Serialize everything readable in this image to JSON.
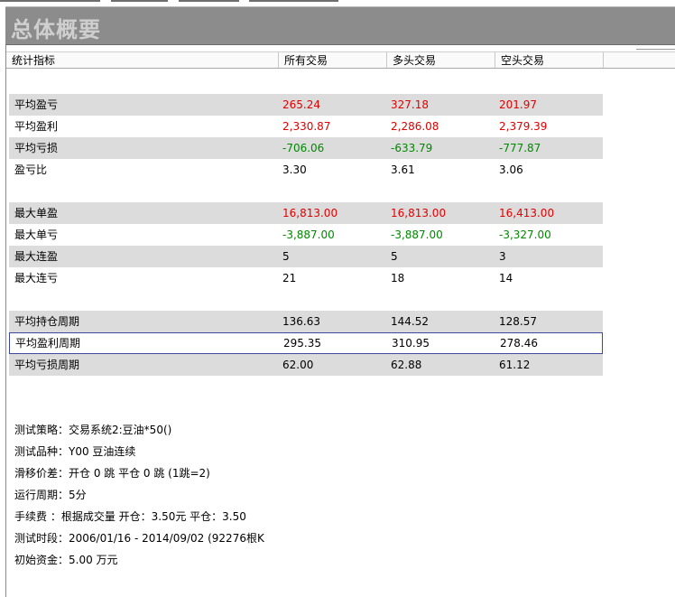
{
  "header": {
    "title": "总体概要",
    "columns": [
      "统计指标",
      "所有交易",
      "多头交易",
      "空头交易"
    ]
  },
  "rows": [
    {
      "label": "平均盈亏",
      "all": "265.24",
      "long": "327.18",
      "short": "201.97",
      "color": "red"
    },
    {
      "label": "平均盈利",
      "all": "2,330.87",
      "long": "2,286.08",
      "short": "2,379.39",
      "color": "red"
    },
    {
      "label": "平均亏损",
      "all": "-706.06",
      "long": "-633.79",
      "short": "-777.87",
      "color": "green"
    },
    {
      "label": "盈亏比",
      "all": "3.30",
      "long": "3.61",
      "short": "3.06",
      "color": "black"
    },
    {
      "label": "最大单盈",
      "all": "16,813.00",
      "long": "16,813.00",
      "short": "16,413.00",
      "color": "red"
    },
    {
      "label": "最大单亏",
      "all": "-3,887.00",
      "long": "-3,887.00",
      "short": "-3,327.00",
      "color": "green"
    },
    {
      "label": "最大连盈",
      "all": "5",
      "long": "5",
      "short": "3",
      "color": "black"
    },
    {
      "label": "最大连亏",
      "all": "21",
      "long": "18",
      "short": "14",
      "color": "black"
    },
    {
      "label": "平均持仓周期",
      "all": "136.63",
      "long": "144.52",
      "short": "128.57",
      "color": "black"
    },
    {
      "label": "平均盈利周期",
      "all": "295.35",
      "long": "310.95",
      "short": "278.46",
      "color": "black"
    },
    {
      "label": "平均亏损周期",
      "all": "62.00",
      "long": "62.88",
      "short": "61.12",
      "color": "black"
    }
  ],
  "info": [
    "测试策略：交易系统2:豆油*50()",
    "测试品种：Y00 豆油连续",
    "滑移价差：开仓 0 跳 平仓 0 跳 (1跳=2)",
    "运行周期：5分",
    "手续费  ：根据成交量 开仓：3.50元 平仓：3.50",
    "测试时段：2006/01/16 - 2014/09/02 (92276根K",
    "初始资金：5.00 万元"
  ],
  "colors": {
    "positive": "#e00000",
    "negative": "#008800",
    "row_shade": "#dcdcdc",
    "selection": "#3b4aa0",
    "title_bar": "#8c8c8c"
  }
}
